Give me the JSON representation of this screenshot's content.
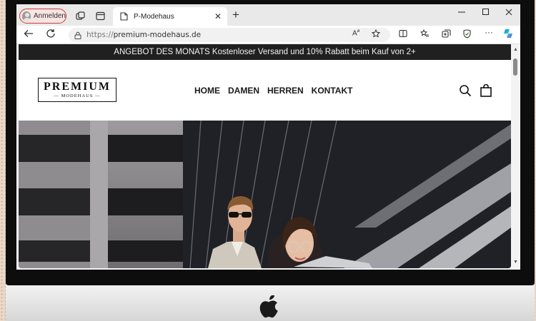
{
  "browser": {
    "profile_label": "Anmelden",
    "tab_title": "P-Modehaus",
    "url_scheme": "https://",
    "url_host": "premium-modehaus.de",
    "new_tab_symbol": "+",
    "close_tab_symbol": "✕"
  },
  "site": {
    "announcement": "ANGEBOT DES MONATS Kostenloser Versand und 10% Rabatt beim Kauf von 2+",
    "logo_main": "PREMIUM",
    "logo_sub": "— MODEHAUS —",
    "nav": [
      {
        "label": "HOME"
      },
      {
        "label": "DAMEN"
      },
      {
        "label": "HERREN"
      },
      {
        "label": "KONTAKT"
      }
    ]
  },
  "icons": {
    "search": "search-icon",
    "cart": "shopping-bag-icon",
    "back": "back-arrow-icon",
    "reload": "reload-icon",
    "favorite": "star-icon"
  },
  "colors": {
    "announcement_bg": "#202020",
    "profile_border": "#c9403a",
    "copilot_accent": "#1e88e5"
  }
}
